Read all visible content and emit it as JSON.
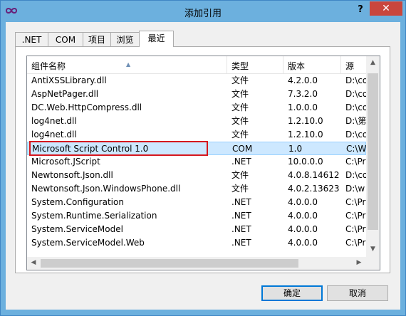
{
  "window": {
    "title": "添加引用",
    "help_label": "?",
    "close_label": "✕"
  },
  "tabs": [
    {
      "label": ".NET"
    },
    {
      "label": "COM"
    },
    {
      "label": "项目"
    },
    {
      "label": "浏览"
    },
    {
      "label": "最近"
    }
  ],
  "columns": [
    "组件名称",
    "类型",
    "版本",
    "源"
  ],
  "rows": [
    {
      "name": "AntiXSSLibrary.dll",
      "type": "文件",
      "version": "4.2.0.0",
      "source": "D:\\co"
    },
    {
      "name": "AspNetPager.dll",
      "type": "文件",
      "version": "7.3.2.0",
      "source": "D:\\co"
    },
    {
      "name": "DC.Web.HttpCompress.dll",
      "type": "文件",
      "version": "1.0.0.0",
      "source": "D:\\co"
    },
    {
      "name": "log4net.dll",
      "type": "文件",
      "version": "1.2.10.0",
      "source": "D:\\第"
    },
    {
      "name": "log4net.dll",
      "type": "文件",
      "version": "1.2.10.0",
      "source": "D:\\co"
    },
    {
      "name": "Microsoft Script Control 1.0",
      "type": "COM",
      "version": "1.0",
      "source": "C:\\W"
    },
    {
      "name": "Microsoft.JScript",
      "type": ".NET",
      "version": "10.0.0.0",
      "source": "C:\\Pr"
    },
    {
      "name": "Newtonsoft.Json.dll",
      "type": "文件",
      "version": "4.0.8.14612",
      "source": "D:\\co"
    },
    {
      "name": "Newtonsoft.Json.WindowsPhone.dll",
      "type": "文件",
      "version": "4.0.2.13623",
      "source": "D:\\w"
    },
    {
      "name": "System.Configuration",
      "type": ".NET",
      "version": "4.0.0.0",
      "source": "C:\\Pr"
    },
    {
      "name": "System.Runtime.Serialization",
      "type": ".NET",
      "version": "4.0.0.0",
      "source": "C:\\Pr"
    },
    {
      "name": "System.ServiceModel",
      "type": ".NET",
      "version": "4.0.0.0",
      "source": "C:\\Pr"
    },
    {
      "name": "System.ServiceModel.Web",
      "type": ".NET",
      "version": "4.0.0.0",
      "source": "C:\\Pr"
    }
  ],
  "buttons": {
    "ok": "确定",
    "cancel": "取消"
  },
  "colors": {
    "titlebar": "#6cb0de",
    "close": "#c9463d",
    "selection": "#cde8ff",
    "highlight_box": "#d6161d"
  }
}
